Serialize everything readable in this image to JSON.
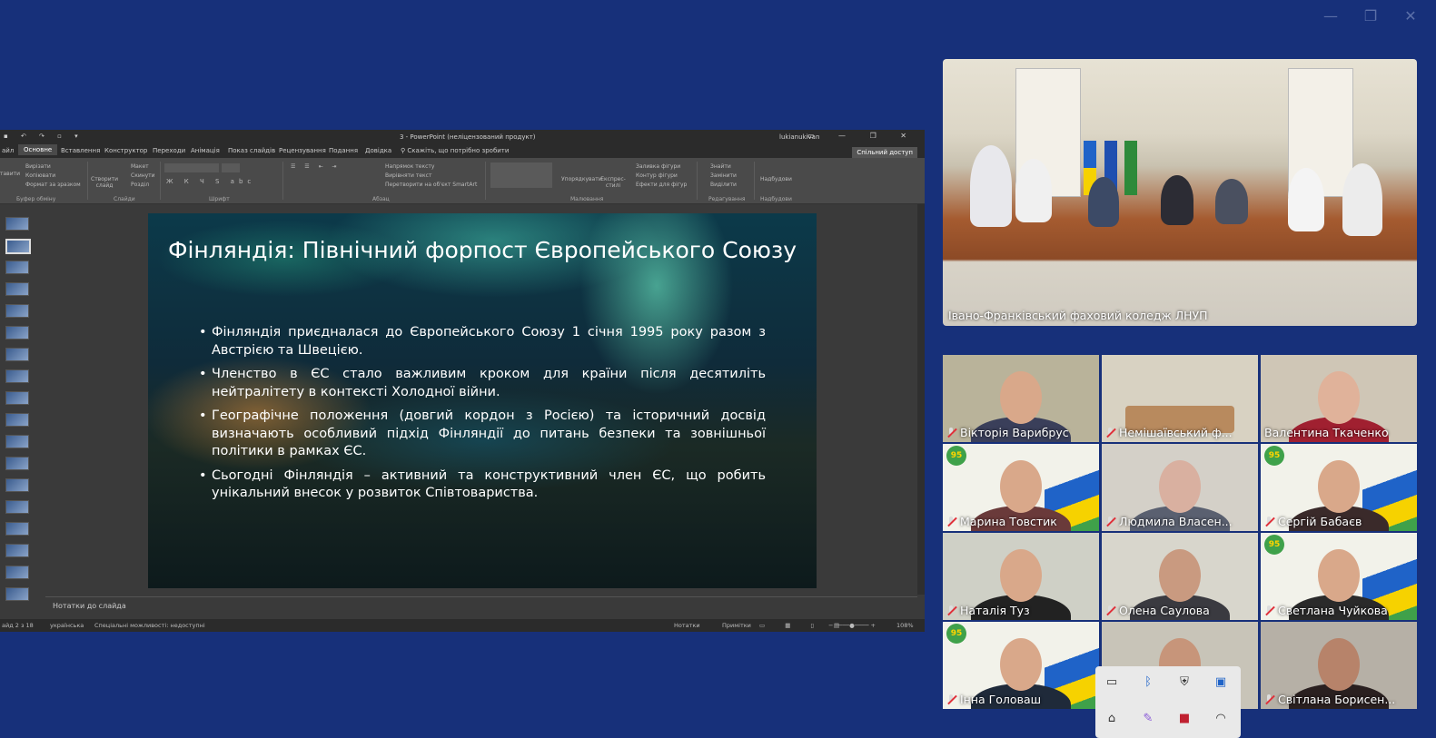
{
  "ppt": {
    "window_title": "3 - PowerPoint (неліцензований продукт)",
    "user": "lukianukivan",
    "tabs": [
      "айл",
      "Основне",
      "Вставлення",
      "Конструктор",
      "Переходи",
      "Анімація",
      "Показ слайдів",
      "Рецензування",
      "Подання",
      "Довідка"
    ],
    "tellme": "Скажіть, що потрібно зробити",
    "share": "Спільний доступ",
    "ribbon": {
      "clipboard": {
        "cut": "Вирізати",
        "copy": "Копіювати",
        "format": "Формат за зразком",
        "group": "Буфер обміну",
        "paste": "тавити"
      },
      "slides": {
        "new": "Створити слайд",
        "layout": "Макет",
        "reset": "Скинути",
        "section": "Розділ",
        "group": "Слайди"
      },
      "font_group": "Шрифт",
      "paragraph": {
        "direction": "Напрямок тексту",
        "align": "Вирівняти текст",
        "smartart": "Перетворити на об'єкт SmartArt",
        "group": "Абзац"
      },
      "drawing": {
        "arrange": "Упорядкувати",
        "quick": "Експрес-стилі",
        "fill": "Заливка фігури",
        "outline": "Контур фігури",
        "effects": "Ефекти для фігур",
        "group": "Малювання"
      },
      "editing": {
        "find": "Знайти",
        "replace": "Замінити",
        "select": "Виділити",
        "group": "Редагування"
      },
      "addins": {
        "label": "Надбудови",
        "group": "Надбудови"
      }
    },
    "slide": {
      "title": "Фінляндія: Північний форпост Європейського Союзу",
      "bullets": [
        "Фінляндія приєдналася до Європейського Союзу 1 січня 1995 року разом з Австрією та Швецією.",
        "Членство в ЄС стало важливим кроком для країни після десятиліть нейтралітету в контексті Холодної війни.",
        "Географічне положення (довгий кордон з Росією) та історичний досвід визначають особливий підхід Фінляндії до питань безпеки та зовнішньої політики в рамках ЄС.",
        "Сьогодні Фінляндія – активний та конструктивний член ЄС, що робить унікальний внесок у розвиток Співтовариства."
      ]
    },
    "notes": "Нотатки до слайда",
    "status": {
      "slide": "айд 2 з 18",
      "language": "українська",
      "accessibility": "Спеціальні можливості: недоступні",
      "notes_btn": "Нотатки",
      "comments_btn": "Примітки",
      "zoom": "108%"
    }
  },
  "main_video": {
    "label": "Івано-Франківський фаховий коледж ЛНУП"
  },
  "participants": [
    {
      "name": "Вікторія Варибрус"
    },
    {
      "name": "Немішаївський ф..."
    },
    {
      "name": "Валентина Ткаченко"
    },
    {
      "name": "Марина Товстик"
    },
    {
      "name": "Людмила Власен..."
    },
    {
      "name": "Сергій Бабаєв"
    },
    {
      "name": "Наталія Туз"
    },
    {
      "name": "Олена Саулова"
    },
    {
      "name": "Светлана Чуйкова"
    },
    {
      "name": "Інна Головаш"
    },
    {
      "name": ""
    },
    {
      "name": "Світлана Борисен..."
    }
  ],
  "badge": "95",
  "colors": {
    "background": "#17307a",
    "mic_off": "#e0303a",
    "flag_blue": "#1f63c8",
    "flag_yellow": "#f6d200",
    "green": "#3fa14a"
  }
}
